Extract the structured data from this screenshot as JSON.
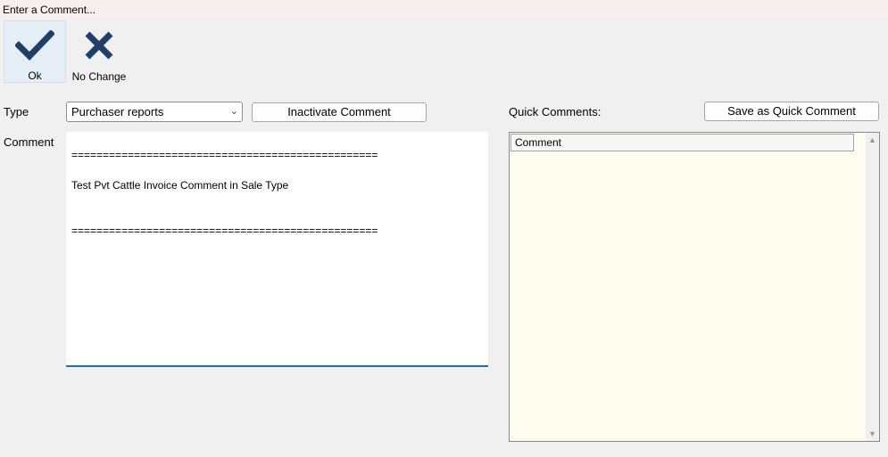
{
  "window": {
    "title": "Enter a Comment..."
  },
  "toolbar": {
    "ok_label": "Ok",
    "no_change_label": "No Change"
  },
  "form": {
    "type_label": "Type",
    "type_value": "Purchaser reports",
    "inactivate_label": "Inactivate Comment",
    "comment_label": "Comment",
    "comment_text": "=================================================\n\nTest Pvt Cattle Invoice Comment in Sale Type\n\n\n=================================================",
    "quick_comments_label": "Quick Comments:",
    "save_quick_label": "Save as Quick Comment"
  },
  "quick_grid": {
    "column_header": "Comment"
  },
  "colors": {
    "ok_icon": "#1f3f66",
    "nochange_icon": "#1f3f66",
    "focus_underline": "#1f6fb2",
    "grid_background": "#fdfdf0"
  }
}
